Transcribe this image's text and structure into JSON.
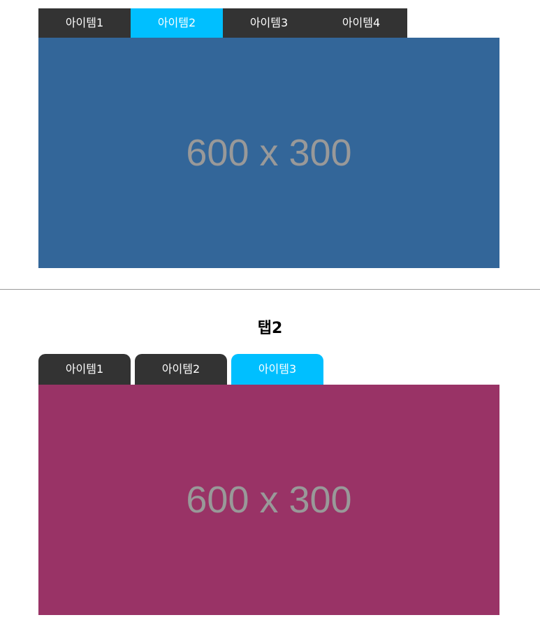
{
  "tabs_section_1": {
    "items": [
      {
        "label": "아이템1",
        "active": false
      },
      {
        "label": "아이템2",
        "active": true
      },
      {
        "label": "아이템3",
        "active": false
      },
      {
        "label": "아이템4",
        "active": false
      }
    ],
    "panel": {
      "placeholder_text": "600 x 300",
      "background_color": "#336699"
    }
  },
  "tabs_section_2": {
    "title": "탭2",
    "items": [
      {
        "label": "아이템1",
        "active": false
      },
      {
        "label": "아이템2",
        "active": false
      },
      {
        "label": "아이템3",
        "active": true
      }
    ],
    "panel": {
      "placeholder_text": "600 x 300",
      "background_color": "#993366"
    }
  },
  "colors": {
    "tab_inactive": "#333333",
    "tab_active": "#00bfff",
    "placeholder_text": "#999999",
    "divider": "#999999"
  }
}
